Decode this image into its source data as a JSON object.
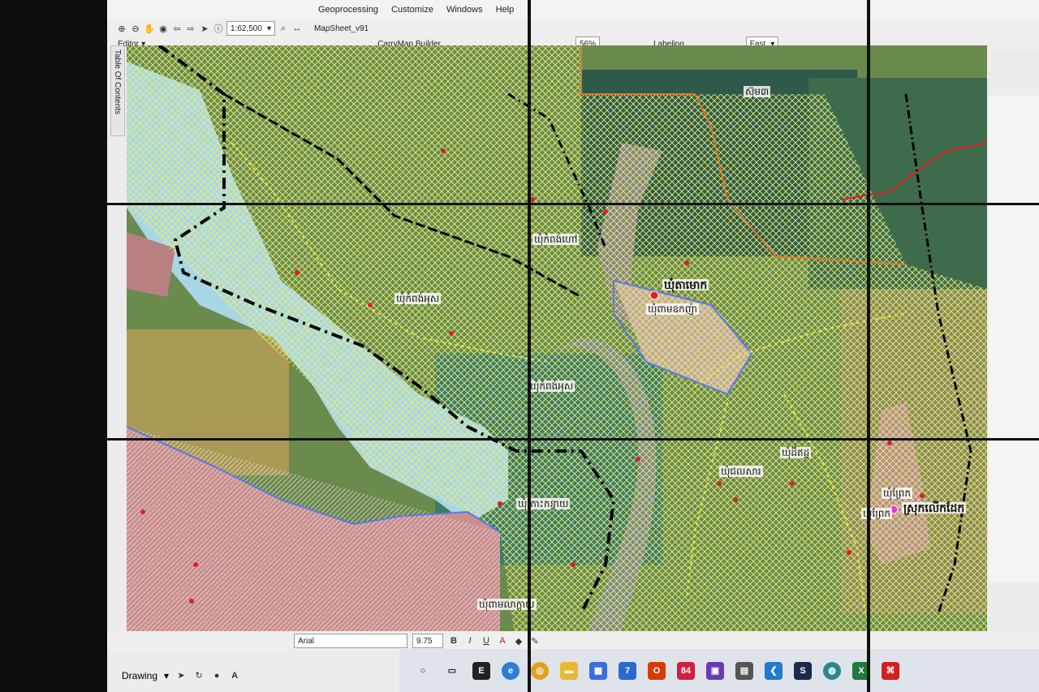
{
  "menu": {
    "items": [
      "Geoprocessing",
      "Customize",
      "Windows",
      "Help"
    ]
  },
  "toolbar": {
    "scale": "1:62,500",
    "editor_label": "Editor",
    "mapsheet_label": "MapSheet_v91",
    "carrymap_label": "CarryMap Builder",
    "zoom_value": "56%",
    "labeling_label": "Labeling",
    "fast_value": "Fast"
  },
  "toc": {
    "label": "Table Of Contents"
  },
  "map": {
    "labels": {
      "l1": "ឃុំកំពង់ហៅ",
      "l2": "ឃុំកំពង់អុស",
      "l3": "ឃុំតាមោក",
      "l4": "ឃុំពាមឧកញ៉ា",
      "l5": "ឃុំកំពង់អុស",
      "l6": "ឃុំកោះកន្ធាយ",
      "l7": "ឃុំដីឥដ្ឋ",
      "l8": "ឃុំជលសារ",
      "l9": "ឃុំព្រែក",
      "l10": "ឃុំព្រែក",
      "l11": "ស្រុកលើកដែក",
      "l12": "ឃុំពាមលាក្តាយ",
      "l13": "ស៊ុម៣"
    },
    "colors": {
      "water": "#a9d6e5",
      "hatch": "#e8ef7a",
      "boundary_black": "#000000",
      "boundary_blue": "#5a78e8",
      "boundary_orange": "#e07a28",
      "boundary_red": "#e02020",
      "boundary_yellow": "#e6e63c",
      "urban_pink": "#c98f8f"
    }
  },
  "drawing": {
    "drawing_label": "Drawing",
    "font_name": "Arial",
    "font_size": "9.75",
    "bold": "B",
    "italic": "I",
    "underline": "U"
  },
  "taskbar": {
    "icons": [
      "search-icon",
      "task-view-icon",
      "epic-games-icon",
      "edge-icon",
      "chrome-icon",
      "file-explorer-icon",
      "store-icon",
      "mail-icon",
      "office-icon",
      "app-icon",
      "save-icon",
      "calculator-icon",
      "vscode-icon",
      "steam-icon",
      "browser-icon",
      "excel-icon",
      "acrobat-icon"
    ],
    "mail_badge": "7",
    "red_badge": "84"
  }
}
